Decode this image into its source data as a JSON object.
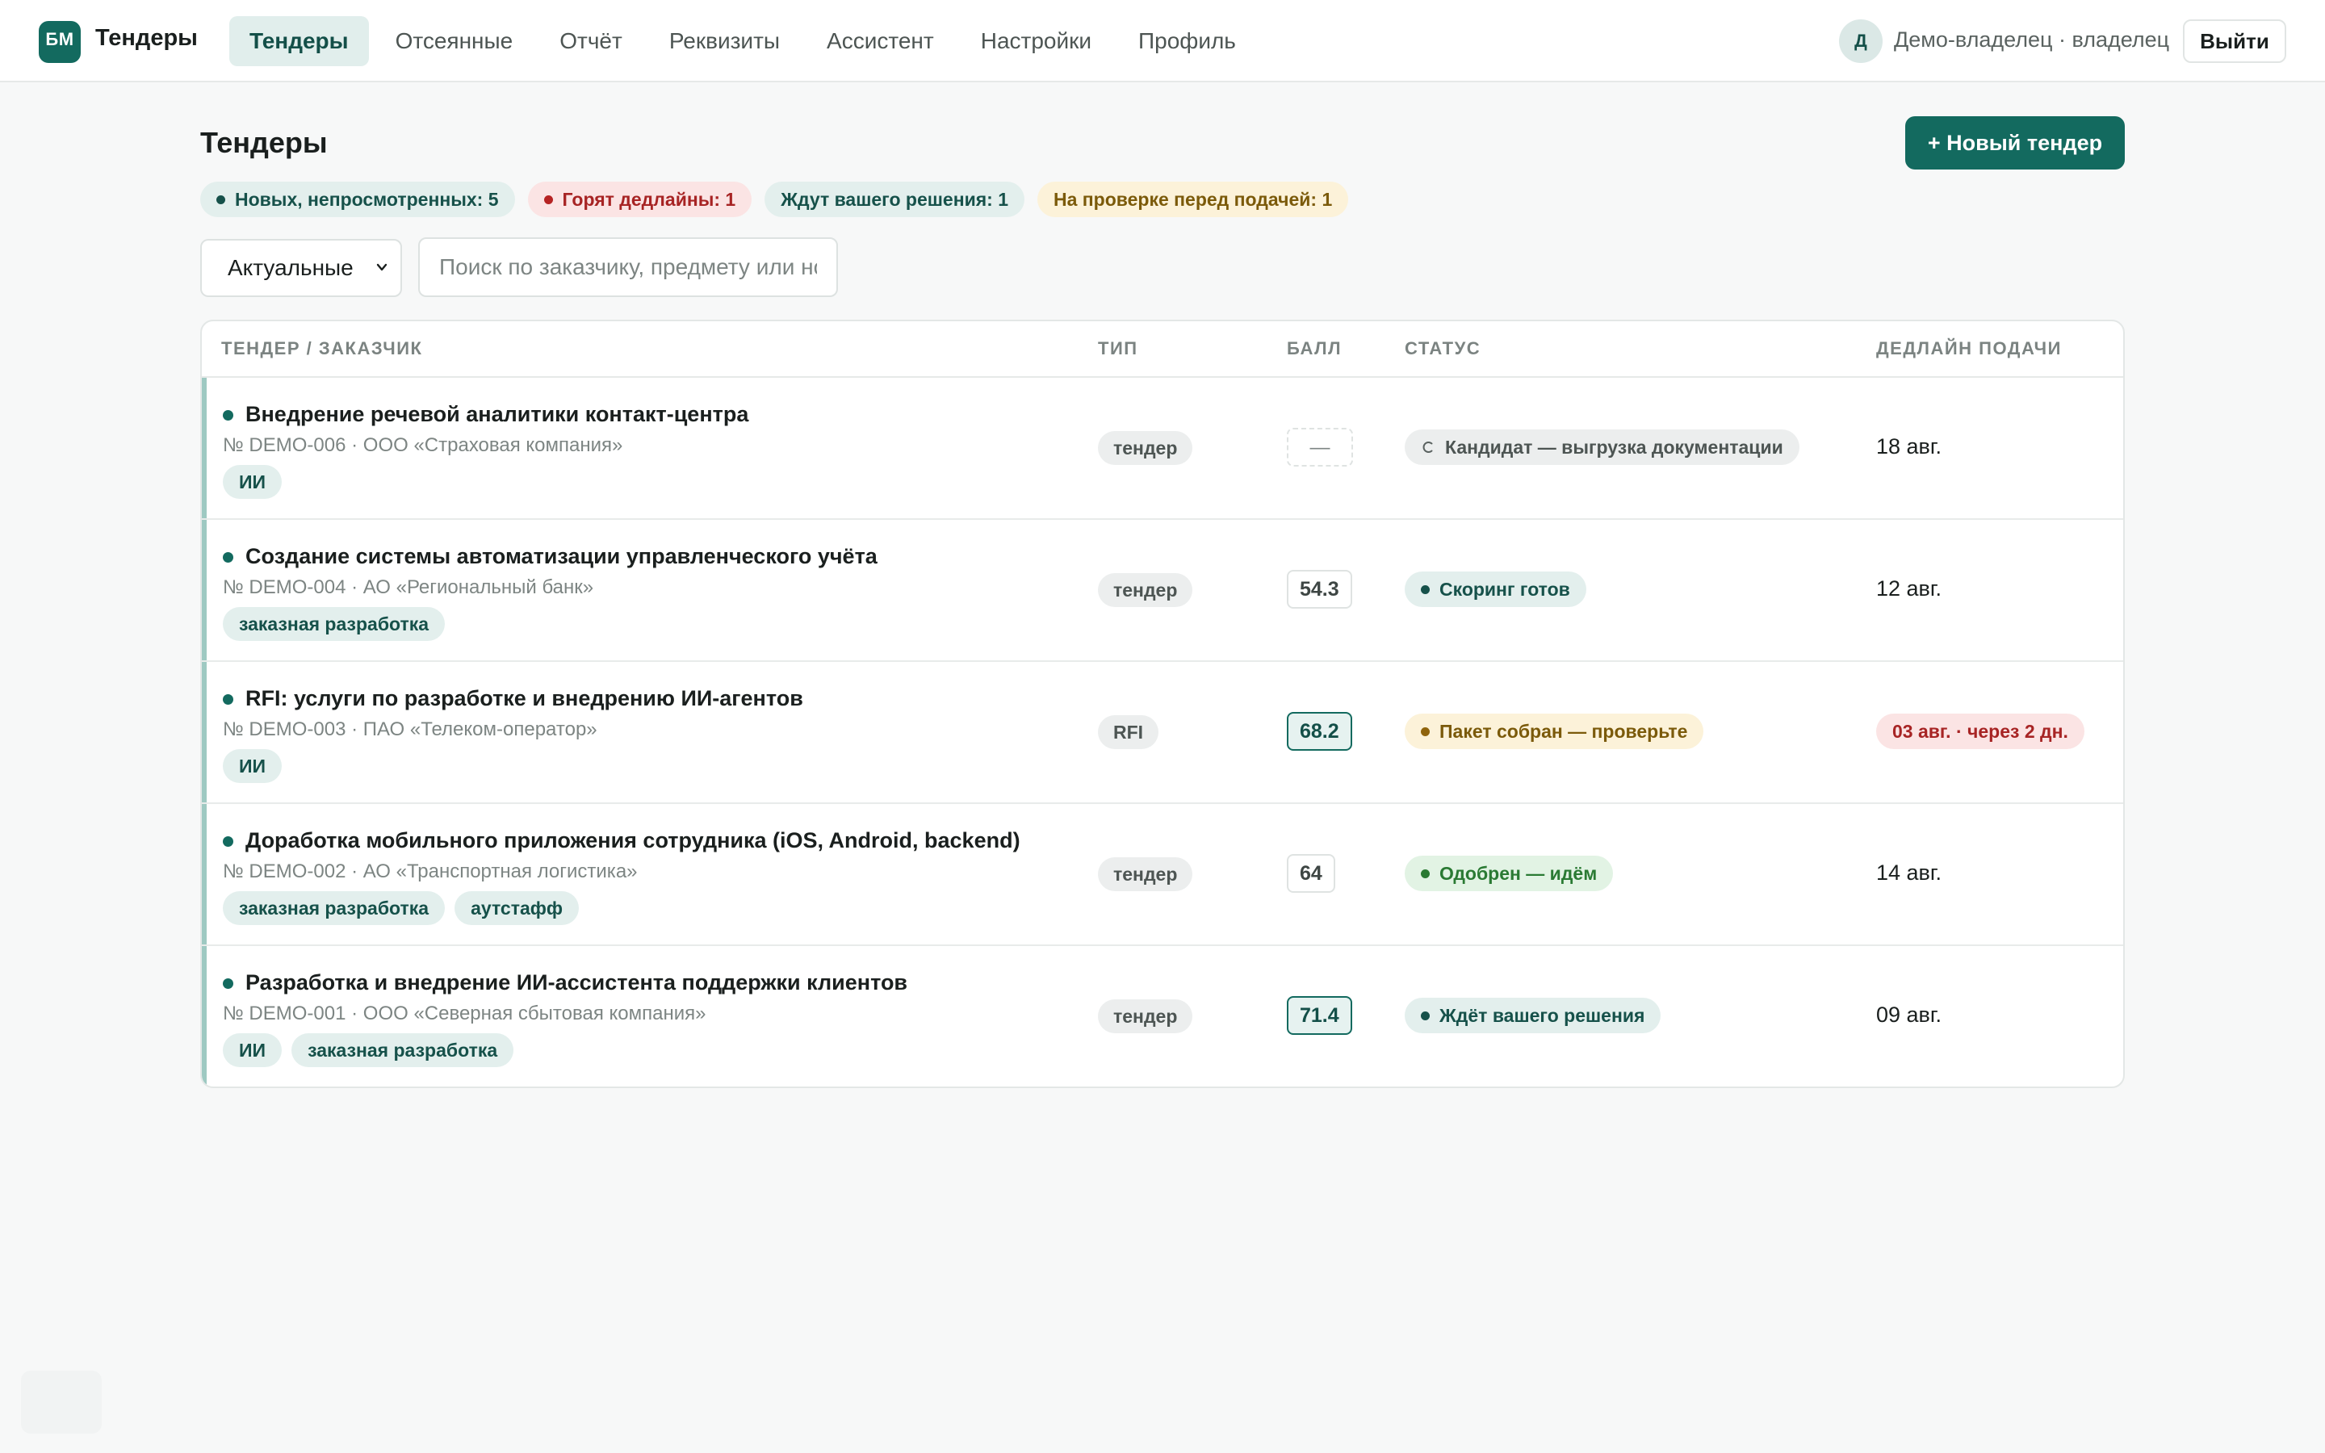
{
  "app": {
    "logo": "БМ",
    "title": "Тендеры"
  },
  "nav": [
    {
      "label": "Тендеры",
      "active": true
    },
    {
      "label": "Отсеянные"
    },
    {
      "label": "Отчёт"
    },
    {
      "label": "Реквизиты"
    },
    {
      "label": "Ассистент"
    },
    {
      "label": "Настройки"
    },
    {
      "label": "Профиль"
    }
  ],
  "user": {
    "initial": "Д",
    "name": "Демо-владелец · владелец",
    "logout_label": "Выйти"
  },
  "page": {
    "title": "Тендеры",
    "new_button_label": "+ Новый тендер"
  },
  "chips": [
    {
      "label": "Новых, непросмотренных: 5",
      "tone": "teal",
      "dot": true
    },
    {
      "label": "Горят дедлайны: 1",
      "tone": "red",
      "dot": true
    },
    {
      "label": "Ждут вашего решения: 1",
      "tone": "teal",
      "dot": false
    },
    {
      "label": "На проверке перед подачей: 1",
      "tone": "amber",
      "dot": false
    }
  ],
  "filters": {
    "selected": "Актуальные",
    "search_placeholder": "Поиск по заказчику, предмету или номеру"
  },
  "table": {
    "headers": {
      "tender": "ТЕНДЕР / ЗАКАЗЧИК",
      "type": "ТИП",
      "score": "БАЛЛ",
      "status": "СТАТУС",
      "deadline": "ДЕДЛАЙН ПОДАЧИ"
    },
    "rows": [
      {
        "title": "Внедрение речевой аналитики контакт-центра",
        "sub": "№ DEMO-006 · ООО «Страховая компания»",
        "tags": [
          "ИИ"
        ],
        "type": "тендер",
        "score": "—",
        "score_style": "empty",
        "status": "Кандидат — выгрузка документации",
        "status_style": "gray",
        "deadline": "18 авг.",
        "urgent": false
      },
      {
        "title": "Создание системы автоматизации управленческого учёта",
        "sub": "№ DEMO-004 · АО «Региональный банк»",
        "tags": [
          "заказная разработка"
        ],
        "type": "тендер",
        "score": "54.3",
        "score_style": "normal",
        "status": "Скоринг готов",
        "status_style": "teal",
        "deadline": "12 авг.",
        "urgent": false
      },
      {
        "title": "RFI: услуги по разработке и внедрению ИИ-агентов",
        "sub": "№ DEMO-003 · ПАО «Телеком-оператор»",
        "tags": [
          "ИИ"
        ],
        "type": "RFI",
        "score": "68.2",
        "score_style": "high",
        "status": "Пакет собран — проверьте",
        "status_style": "amber",
        "deadline": "03 авг. · через 2 дн.",
        "urgent": true
      },
      {
        "title": "Доработка мобильного приложения сотрудника (iOS, Android, backend)",
        "sub": "№ DEMO-002 · АО «Транспортная логистика»",
        "tags": [
          "заказная разработка",
          "аутстафф"
        ],
        "type": "тендер",
        "score": "64",
        "score_style": "normal",
        "status": "Одобрен — идём",
        "status_style": "green",
        "deadline": "14 авг.",
        "urgent": false
      },
      {
        "title": "Разработка и внедрение ИИ-ассистента поддержки клиентов",
        "sub": "№ DEMO-001 · ООО «Северная сбытовая компания»",
        "tags": [
          "ИИ",
          "заказная разработка"
        ],
        "type": "тендер",
        "score": "71.4",
        "score_style": "high",
        "status": "Ждёт вашего решения",
        "status_style": "teal",
        "deadline": "09 авг.",
        "urgent": false
      }
    ]
  }
}
